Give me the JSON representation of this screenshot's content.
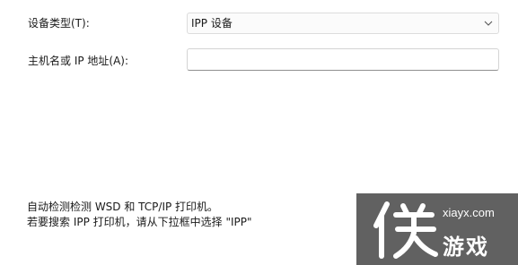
{
  "form": {
    "device_type": {
      "label": "设备类型(T):",
      "selected_value": "IPP 设备",
      "icon": "chevron-down-icon"
    },
    "hostname": {
      "label": "主机名或 IP 地址(A):",
      "value": ""
    }
  },
  "hints": {
    "line1": "自动检测检测 WSD 和 TCP/IP 打印机。",
    "line2": "若要搜索 IPP 打印机，请从下拉框中选择 \"IPP\""
  },
  "watermark": {
    "glyph": "侠",
    "domain": "xiayx.com",
    "name": "游戏"
  }
}
